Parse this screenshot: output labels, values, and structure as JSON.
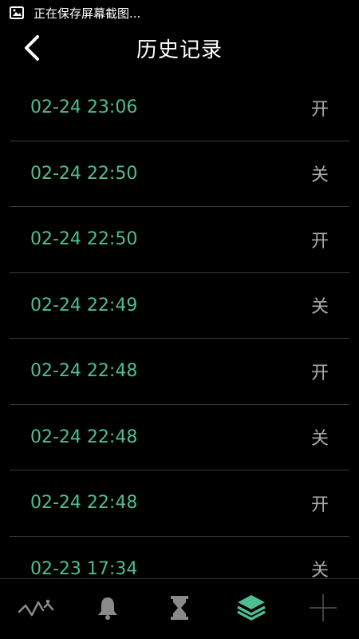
{
  "status_bar": {
    "notification_icon": "image-icon",
    "text": "正在保存屏幕截图..."
  },
  "header": {
    "back_icon": "chevron-left-icon",
    "title": "历史记录"
  },
  "records": [
    {
      "time": "02-24 23:06",
      "state": "开"
    },
    {
      "time": "02-24 22:50",
      "state": "关"
    },
    {
      "time": "02-24 22:50",
      "state": "开"
    },
    {
      "time": "02-24 22:49",
      "state": "关"
    },
    {
      "time": "02-24 22:48",
      "state": "开"
    },
    {
      "time": "02-24 22:48",
      "state": "关"
    },
    {
      "time": "02-24 22:48",
      "state": "开"
    },
    {
      "time": "02-23 17:34",
      "state": "关"
    }
  ],
  "tab_bar": {
    "active_index": 3,
    "tabs": [
      {
        "icon": "chart-line-icon"
      },
      {
        "icon": "bell-icon"
      },
      {
        "icon": "hourglass-icon"
      },
      {
        "icon": "layers-icon"
      },
      {
        "icon": "plus-icon"
      }
    ]
  },
  "colors": {
    "background": "#000000",
    "time_text": "#4fbd8f",
    "state_text": "#a8a8a8",
    "active_tab": "#4fbd8f",
    "inactive_tab": "#8a8a8a"
  }
}
